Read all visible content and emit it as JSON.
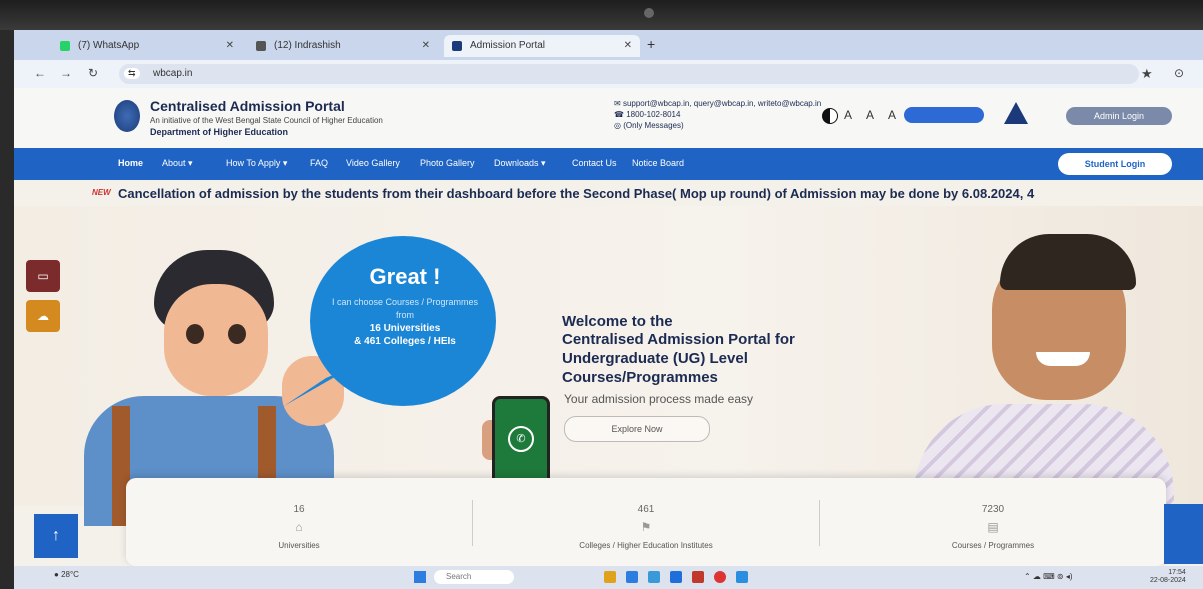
{
  "browser": {
    "tabs": [
      {
        "label": "(7) WhatsApp",
        "active": false
      },
      {
        "label": "(12) Indrashish",
        "active": false
      },
      {
        "label": "Admission Portal",
        "active": true
      }
    ],
    "url": "wbcap.in"
  },
  "site": {
    "title": "Centralised Admission Portal",
    "subtitle": "An initiative of the West Bengal State Council of Higher Education",
    "department": "Department of Higher Education",
    "contact": {
      "email": "support@wbcap.in, query@wbcap.in, writeto@wbcap.in",
      "phone": "1800-102-8014",
      "whatsapp": "(Only Messages)"
    },
    "font_sizes": "A A A",
    "admin_login": "Admin Login",
    "student_login": "Student Login"
  },
  "nav": [
    "Home",
    "About ▾",
    "How To Apply ▾",
    "FAQ",
    "Video Gallery",
    "Photo Gallery",
    "Downloads ▾",
    "Contact Us",
    "Notice Board"
  ],
  "ticker": {
    "badge": "NEW",
    "text": "Cancellation of admission by the students from their dashboard before the Second Phase( Mop up round) of Admission may be done by 6.08.2024, 4"
  },
  "hero": {
    "bubble_title": "Great !",
    "bubble_line1": "I can choose Courses / Programmes from",
    "bubble_line2": "16 Universities",
    "bubble_line3": "& 461 Colleges / HEIs",
    "welcome_line1": "Welcome to the",
    "welcome_line2": "Centralised Admission Portal for Undergraduate (UG) Level Courses/Programmes",
    "tagline": "Your admission process made easy",
    "cta": "Explore Now"
  },
  "stats": [
    {
      "value": "16",
      "label": "Universities"
    },
    {
      "value": "461",
      "label": "Colleges / Higher Education Institutes"
    },
    {
      "value": "7230",
      "label": "Courses / Programmes"
    }
  ],
  "taskbar": {
    "search_placeholder": "Search",
    "weather": "28°C",
    "time": "17:54",
    "date": "22-08-2024"
  }
}
